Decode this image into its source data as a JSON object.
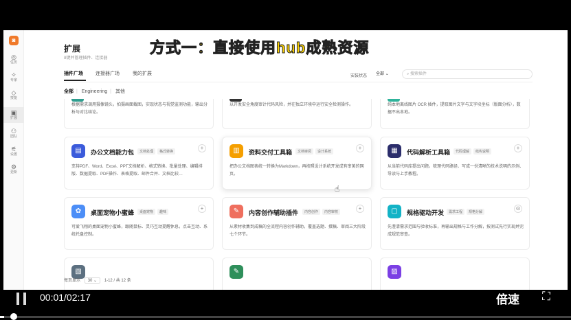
{
  "player": {
    "current_time": "00:01",
    "duration": "02:17",
    "time_display": "00:01/02:17",
    "speed_label": "倍速",
    "progress_fraction": 0.007
  },
  "banner": {
    "text": "方式一：直接使用hub成熟资源"
  },
  "page": {
    "title": "扩展",
    "subtitle": "8键并管理插件、连接器"
  },
  "tabs": [
    "插件广场",
    "连接器广场",
    "我的扩展"
  ],
  "status": {
    "label": "安装状态",
    "selected": "全部"
  },
  "search": {
    "placeholder": "搜索插件"
  },
  "filters": [
    "全部",
    "Engineering",
    "其他"
  ],
  "rail": [
    {
      "icon": "◎",
      "label": "任务"
    },
    {
      "icon": "✧",
      "label": "专家"
    },
    {
      "icon": "◇",
      "label": "技能"
    },
    {
      "icon": "▣",
      "label": "扩展"
    },
    {
      "icon": "⚇",
      "label": "团队"
    },
    {
      "icon": "⚟",
      "label": "设置"
    },
    {
      "icon": "⚙",
      "label": "更新"
    }
  ],
  "partial_cards": [
    {
      "desc": "根据需求调用摄像镜头，拍摄画面截图，实现状态与视觉监测功能，输出分析与对比结论。",
      "color": "#2f9e8f"
    },
    {
      "desc": "以开发安全角度审计代码风险，并在独立环境中运行安全检测操作。",
      "color": "#333333"
    },
    {
      "desc": "纯本地离线图片 OCR 插件，提取图片文字与文字块坐标（版面分析），数据不出本地。",
      "color": "#2fb39b"
    }
  ],
  "cards": [
    {
      "title": "办公文档能力包",
      "tags": [
        "文档处理",
        "格式转换"
      ],
      "desc": "支持PDF、Word、Excel、PPT文档解析、格式转换、批量处理、编辑排版、数据提取、PDF操作、表格提取、邮件合并、文档比较…",
      "icon": "▤",
      "color": "#3b5bdb"
    },
    {
      "title": "资料交付工具箱",
      "tags": [
        "文档审阅",
        "设计系统"
      ],
      "desc": "把办公文档图表统一转换为Markdown，再按照设计系统开发成有审美的网页。",
      "icon": "▥",
      "color": "#f59f00"
    },
    {
      "title": "代码解析工具箱",
      "tags": [
        "代码理解",
        "结构说明"
      ],
      "desc": "从当前代码库提出问题，梳理代码路径、写成一份清晰的技术说明的示例、导读与上手教程。",
      "icon": "▦",
      "color": "#2b2d6b"
    },
    {
      "title": "桌面宠物小蜜蜂",
      "tags": [
        "桌面宠物",
        "趣味"
      ],
      "desc": "可爱飞翔的桌面宠物小蜜蜂，跟随鼠标、灵巧互动提醒休息，点击互动、系统托盘控制。",
      "icon": "✿",
      "color": "#4c8ef7"
    },
    {
      "title": "内容创作辅助插件",
      "tags": [
        "内容创作",
        "内容审校"
      ],
      "desc": "从素材收集到成稿的全流程内容创作辅助，覆盖选题、撰稿、审阅三大阶段七个环节。",
      "icon": "✎",
      "color": "#ef6f5e"
    },
    {
      "title": "规格驱动开发",
      "tags": [
        "需求工程",
        "规格分解"
      ],
      "desc": "先澄清需求范围与验收标准，再输出规格与工作分解，按测试先行实现并完成规范审查。",
      "icon": "▢",
      "color": "#13b3c6"
    },
    {
      "title": "",
      "tags": [],
      "desc": "",
      "icon": "▧",
      "color": "#5c7080"
    },
    {
      "title": "",
      "tags": [],
      "desc": "",
      "icon": "✎",
      "color": "#2f8f5b"
    },
    {
      "title": "",
      "tags": [],
      "desc": "",
      "icon": "▨",
      "color": "#7b3fe4"
    }
  ],
  "pager": {
    "label": "每页显示",
    "page_size": "30",
    "range": "1-12 / 共 12 条"
  }
}
